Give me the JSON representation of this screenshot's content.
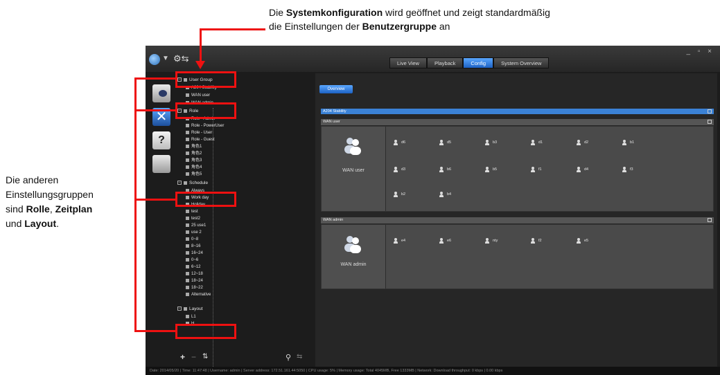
{
  "annotations": {
    "top": {
      "part1": "Die ",
      "bold1": "Systemkonfiguration",
      "part2": " wird geöffnet und zeigt standardmäßig",
      "part3": "die Einstellungen der ",
      "bold2": "Benutzergruppe",
      "part4": " an"
    },
    "left": {
      "line1": "Die anderen",
      "line2": "Einstellungsgruppen",
      "line3a": "sind ",
      "line3b": "Rolle",
      "line3c": ", ",
      "line3d": "Zeitplan",
      "line4a": "und ",
      "line4b": "Layout",
      "line4c": "."
    }
  },
  "topbar": {
    "tabs": [
      "Live View",
      "Playback",
      "Config",
      "System Overview"
    ],
    "active_tab": "Config",
    "window_controls": "_ ▫ ×"
  },
  "tree": {
    "user_group": {
      "label": "User Group",
      "children": [
        "A204 Stability",
        "WAN user",
        "WAN admin"
      ]
    },
    "role": {
      "label": "Role",
      "children": [
        "Role - Admin",
        "Role - PowerUser",
        "Role - User",
        "Role - Guest",
        "角色1",
        "角色2",
        "角色3",
        "角色4",
        "角色5"
      ]
    },
    "schedule": {
      "label": "Schedule",
      "children": [
        "Always",
        "Work day",
        "Holiday",
        "test",
        "test2",
        "25 use1",
        "use 2",
        "0~8",
        "8~16",
        "16~24",
        "0~6",
        "6~12",
        "12~18",
        "18~24",
        "18~22",
        "Alternative"
      ]
    },
    "layout": {
      "label": "Layout",
      "children": [
        "L1",
        "H"
      ]
    }
  },
  "main": {
    "overview_button": "Overview",
    "group_header": "A204 Stability",
    "sections": [
      {
        "header": "WAN user",
        "group_name": "WAN user",
        "users": [
          "d6",
          "d5",
          "b3",
          "d1",
          "d2",
          "b1",
          "d3",
          "b6",
          "b5",
          "f1",
          "d4",
          "f3",
          "b2",
          "b4"
        ]
      },
      {
        "header": "WAN admin",
        "group_name": "WAN admin",
        "users": [
          "e4",
          "e6",
          "nty",
          "f2",
          "e5"
        ]
      }
    ]
  },
  "statusbar": "Date: 2014/05/20 | Time: 11:47:48 | Username: admin | Server address: 172.51.161.44:5050 | CPU usage: 5% | Memory usage: Total 4045MB, Free 1333MB | Network: Download throughput: 0 kbps | 0.00 kbps",
  "colors": {
    "accent": "#1d62c4",
    "annotation_red": "#e11111"
  },
  "icons": [
    "globe-icon",
    "tools-icon",
    "camera-settings-icon",
    "config-tools-icon",
    "help-icon",
    "card-icon",
    "add-icon",
    "remove-icon",
    "sort-icon",
    "search-icon",
    "export-icon"
  ]
}
